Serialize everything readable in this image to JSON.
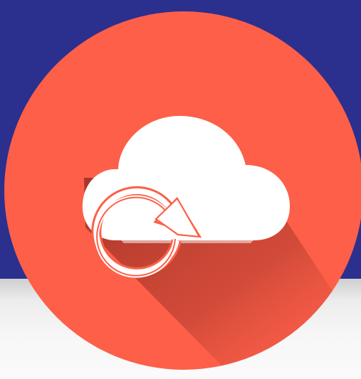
{
  "icon": {
    "name": "cloud-sync-icon",
    "colors": {
      "background_top": "#2b2f8e",
      "background_bottom": "#f2f2f2",
      "circle": "#fd5f49",
      "cloud": "#ffffff",
      "shadow": "#a8362a"
    }
  }
}
